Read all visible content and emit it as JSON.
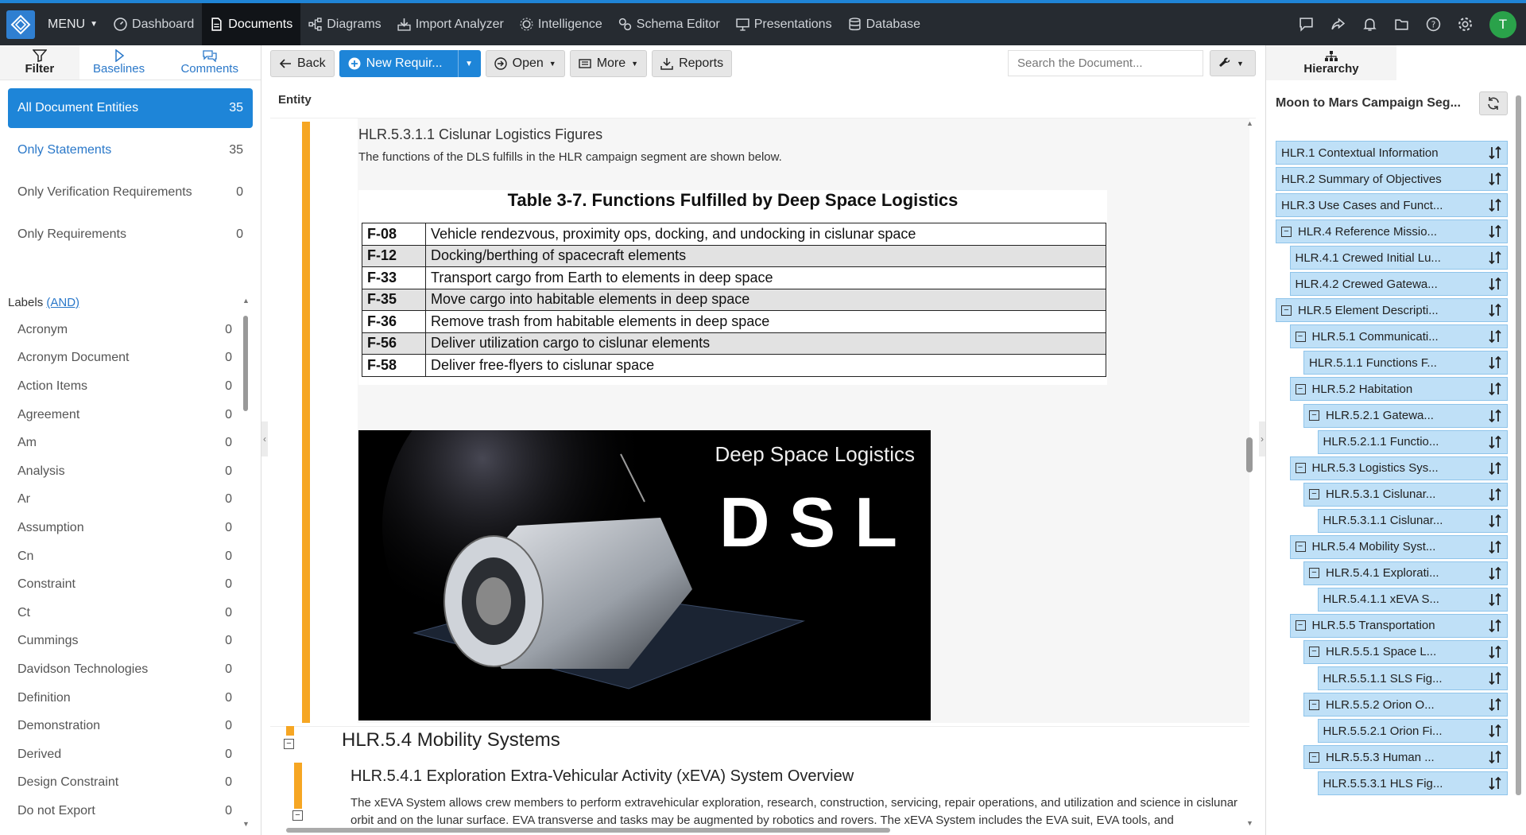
{
  "nav": {
    "menu_label": "MENU",
    "items": [
      {
        "label": "Dashboard",
        "active": false
      },
      {
        "label": "Documents",
        "active": true
      },
      {
        "label": "Diagrams",
        "active": false
      },
      {
        "label": "Import Analyzer",
        "active": false
      },
      {
        "label": "Intelligence",
        "active": false
      },
      {
        "label": "Schema Editor",
        "active": false
      },
      {
        "label": "Presentations",
        "active": false
      },
      {
        "label": "Database",
        "active": false
      }
    ],
    "avatar_initial": "T"
  },
  "sidebar": {
    "tabs": [
      "Filter",
      "Baselines",
      "Comments"
    ],
    "filters": [
      {
        "label": "All Document Entities",
        "count": "35"
      },
      {
        "label": "Only Statements",
        "count": "35"
      },
      {
        "label": "Only Verification Requirements",
        "count": "0"
      },
      {
        "label": "Only Requirements",
        "count": "0"
      }
    ],
    "labels_title": "Labels",
    "labels_mode": "(AND)",
    "labels": [
      {
        "label": "Acronym",
        "count": "0"
      },
      {
        "label": "Acronym Document",
        "count": "0"
      },
      {
        "label": "Action Items",
        "count": "0"
      },
      {
        "label": "Agreement",
        "count": "0"
      },
      {
        "label": "Am",
        "count": "0"
      },
      {
        "label": "Analysis",
        "count": "0"
      },
      {
        "label": "Ar",
        "count": "0"
      },
      {
        "label": "Assumption",
        "count": "0"
      },
      {
        "label": "Cn",
        "count": "0"
      },
      {
        "label": "Constraint",
        "count": "0"
      },
      {
        "label": "Ct",
        "count": "0"
      },
      {
        "label": "Cummings",
        "count": "0"
      },
      {
        "label": "Davidson Technologies",
        "count": "0"
      },
      {
        "label": "Definition",
        "count": "0"
      },
      {
        "label": "Demonstration",
        "count": "0"
      },
      {
        "label": "Derived",
        "count": "0"
      },
      {
        "label": "Design Constraint",
        "count": "0"
      },
      {
        "label": "Do not Export",
        "count": "0"
      }
    ]
  },
  "toolbar": {
    "back": "Back",
    "new_req": "New Requir...",
    "open": "Open",
    "more": "More",
    "reports": "Reports",
    "search_placeholder": "Search the Document..."
  },
  "doc": {
    "entity_header": "Entity",
    "section_title": "HLR.5.3.1.1 Cislunar Logistics Figures",
    "section_text": "The functions of the DLS fulfills in the HLR campaign segment are shown below.",
    "table_title": "Table 3-7. Functions Fulfilled by Deep Space Logistics",
    "table_rows": [
      {
        "code": "F-08",
        "desc": "Vehicle rendezvous, proximity ops, docking, and undocking in cislunar space"
      },
      {
        "code": "F-12",
        "desc": "Docking/berthing of spacecraft elements"
      },
      {
        "code": "F-33",
        "desc": "Transport cargo from Earth to elements in deep space"
      },
      {
        "code": "F-35",
        "desc": "Move cargo into habitable elements in deep space"
      },
      {
        "code": "F-36",
        "desc": "Remove trash from habitable elements in deep space"
      },
      {
        "code": "F-56",
        "desc": "Deliver utilization cargo to cislunar elements"
      },
      {
        "code": "F-58",
        "desc": "Deliver free-flyers to cislunar space"
      }
    ],
    "image_caption": "Deep Space Logistics",
    "image_letters": "DSL",
    "sec2_title": "HLR.5.4 Mobility Systems",
    "sec3_title": "HLR.5.4.1 Exploration Extra-Vehicular Activity (xEVA) System Overview",
    "sec3_text": "The xEVA System allows crew members to perform extravehicular exploration, research, construction, servicing, repair operations, and utilization and science in cislunar orbit and on the lunar surface. EVA transverse and tasks may be augmented by robotics and rovers. The xEVA System includes the EVA suit, EVA tools, and"
  },
  "hierarchy": {
    "tab": "Hierarchy",
    "title": "Moon to Mars Campaign Seg...",
    "nodes": [
      {
        "label": "HLR.1 Contextual Information",
        "indent": 0,
        "toggle": false
      },
      {
        "label": "HLR.2 Summary of Objectives",
        "indent": 0,
        "toggle": false
      },
      {
        "label": "HLR.3 Use Cases and Funct...",
        "indent": 0,
        "toggle": false
      },
      {
        "label": "HLR.4 Reference Missio...",
        "indent": 0,
        "toggle": true
      },
      {
        "label": "HLR.4.1 Crewed Initial Lu...",
        "indent": 1,
        "toggle": false
      },
      {
        "label": "HLR.4.2 Crewed Gatewa...",
        "indent": 1,
        "toggle": false
      },
      {
        "label": "HLR.5 Element Descripti...",
        "indent": 0,
        "toggle": true
      },
      {
        "label": "HLR.5.1 Communicati...",
        "indent": 1,
        "toggle": true
      },
      {
        "label": "HLR.5.1.1 Functions F...",
        "indent": 2,
        "toggle": false
      },
      {
        "label": "HLR.5.2 Habitation",
        "indent": 1,
        "toggle": true
      },
      {
        "label": "HLR.5.2.1 Gatewa...",
        "indent": 2,
        "toggle": true
      },
      {
        "label": "HLR.5.2.1.1 Functio...",
        "indent": 3,
        "toggle": false
      },
      {
        "label": "HLR.5.3 Logistics Sys...",
        "indent": 1,
        "toggle": true
      },
      {
        "label": "HLR.5.3.1 Cislunar...",
        "indent": 2,
        "toggle": true
      },
      {
        "label": "HLR.5.3.1.1 Cislunar...",
        "indent": 3,
        "toggle": false
      },
      {
        "label": "HLR.5.4 Mobility Syst...",
        "indent": 1,
        "toggle": true
      },
      {
        "label": "HLR.5.4.1 Explorati...",
        "indent": 2,
        "toggle": true
      },
      {
        "label": "HLR.5.4.1.1 xEVA S...",
        "indent": 3,
        "toggle": false
      },
      {
        "label": "HLR.5.5 Transportation",
        "indent": 1,
        "toggle": true
      },
      {
        "label": "HLR.5.5.1 Space L...",
        "indent": 2,
        "toggle": true
      },
      {
        "label": "HLR.5.5.1.1 SLS Fig...",
        "indent": 3,
        "toggle": false
      },
      {
        "label": "HLR.5.5.2 Orion O...",
        "indent": 2,
        "toggle": true
      },
      {
        "label": "HLR.5.5.2.1 Orion Fi...",
        "indent": 3,
        "toggle": false
      },
      {
        "label": "HLR.5.5.3 Human ...",
        "indent": 2,
        "toggle": true
      },
      {
        "label": "HLR.5.5.3.1 HLS Fig...",
        "indent": 3,
        "toggle": false
      }
    ]
  }
}
